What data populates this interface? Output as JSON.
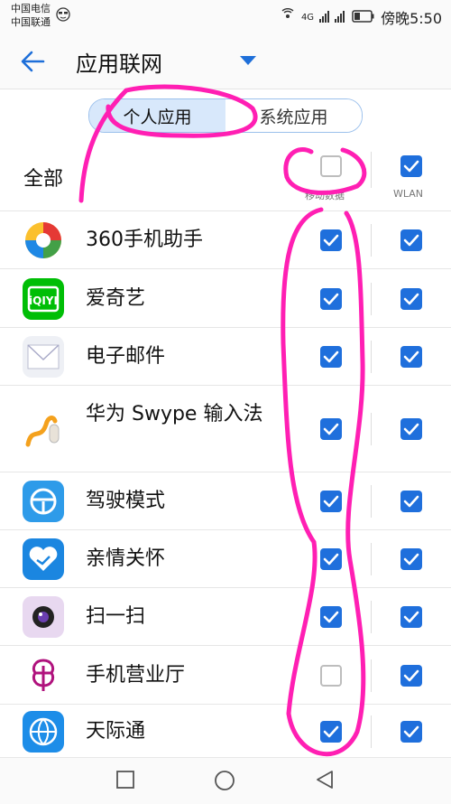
{
  "status": {
    "carrier1": "中国电信",
    "carrier2": "中国联通",
    "network": "4G",
    "battery_level": 0.35,
    "time": "傍晚5:50"
  },
  "header": {
    "back_icon": "back-arrow-icon",
    "title": "应用联网",
    "dropdown_icon": "triangle-down-icon"
  },
  "tabs": [
    {
      "label": "个人应用",
      "active": true
    },
    {
      "label": "系统应用",
      "active": false
    }
  ],
  "all_row": {
    "label": "全部",
    "mobile_data_header": "移动数据",
    "wlan_header": "WLAN",
    "mobile_checked": false,
    "wlan_checked": true
  },
  "apps": [
    {
      "name": "360手机助手",
      "icon": "360-icon",
      "mobile": true,
      "wlan": true
    },
    {
      "name": "爱奇艺",
      "icon": "iqiyi-icon",
      "mobile": true,
      "wlan": true
    },
    {
      "name": "电子邮件",
      "icon": "email-icon",
      "mobile": true,
      "wlan": true
    },
    {
      "name": "华为 Swype 输入法",
      "icon": "swype-icon",
      "mobile": true,
      "wlan": true
    },
    {
      "name": "驾驶模式",
      "icon": "driving-mode-icon",
      "mobile": true,
      "wlan": true
    },
    {
      "name": "亲情关怀",
      "icon": "family-care-icon",
      "mobile": true,
      "wlan": true
    },
    {
      "name": "扫一扫",
      "icon": "scan-icon",
      "mobile": true,
      "wlan": true
    },
    {
      "name": "手机营业厅",
      "icon": "unicom-icon",
      "mobile": false,
      "wlan": true
    },
    {
      "name": "天际通",
      "icon": "skytone-icon",
      "mobile": true,
      "wlan": true
    }
  ],
  "navbar": [
    "square-recent-icon",
    "circle-home-icon",
    "triangle-back-icon"
  ],
  "colors": {
    "accent": "#1f6fdc",
    "annotation": "#ff1fb3"
  }
}
